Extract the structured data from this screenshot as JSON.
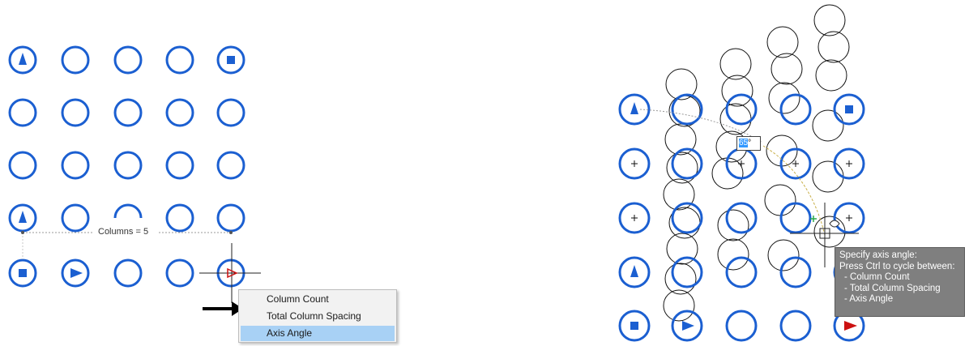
{
  "colors": {
    "marker_blue": "#1b5fd1",
    "red_triangle": "#cc1111",
    "menu_highlight": "#a8d1f5",
    "tooltip_bg": "#7f7f7f"
  },
  "left_panel": {
    "dimension_label": "Columns = 5",
    "context_menu": {
      "items": [
        {
          "label": "Column Count",
          "selected": false
        },
        {
          "label": "Total Column Spacing",
          "selected": false
        },
        {
          "label": "Axis Angle",
          "selected": true
        }
      ]
    }
  },
  "right_panel": {
    "angle_input": {
      "value": "65",
      "unit": "°"
    },
    "tooltip": {
      "line1": "Specify axis angle:",
      "line2": "Press Ctrl to cycle between:",
      "options": [
        "- Column Count",
        "- Total Column Spacing",
        "- Axis Angle"
      ]
    }
  }
}
